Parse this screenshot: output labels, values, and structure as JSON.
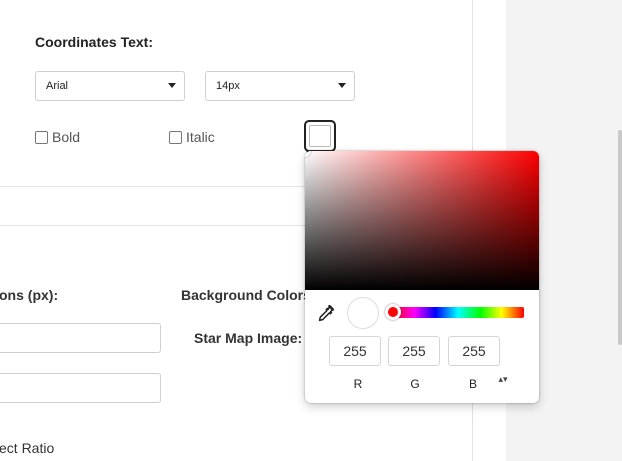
{
  "coordinates_text": {
    "heading": "Coordinates Text:",
    "font_family": "Arial",
    "font_size": "14px",
    "bold_label": "Bold",
    "italic_label": "Italic",
    "swatch_color": "#ffffff"
  },
  "dimensions": {
    "label": "ons (px):",
    "aspect_ratio_label": "ect Ratio"
  },
  "background": {
    "colors_label": "Background Colors:",
    "star_map_label": "Star Map Image:"
  },
  "color_picker": {
    "hue_color": "#ff0000",
    "r": "255",
    "g": "255",
    "b": "255",
    "r_label": "R",
    "g_label": "G",
    "b_label": "B",
    "mode_toggle": "▴▾"
  }
}
